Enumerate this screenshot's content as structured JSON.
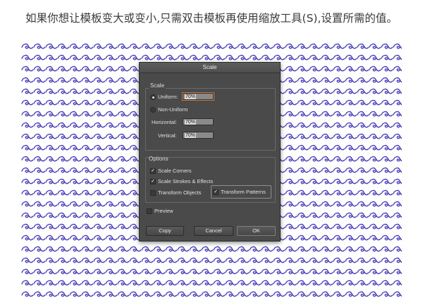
{
  "caption": "如果你想让模板变大或变小,只需双击模板再使用缩放工具(S),设置所需的值。",
  "pattern": {
    "stroke_color": "#4a3fb8",
    "icon": "wave-icon"
  },
  "dialog": {
    "title": "Scale",
    "scale_group": {
      "label": "Scale",
      "uniform_label": "Uniform:",
      "uniform_value": "70%",
      "non_uniform_label": "Non-Uniform",
      "horizontal_label": "Horizontal:",
      "horizontal_value": "70%",
      "vertical_label": "Vertical:",
      "vertical_value": "70%",
      "selected": "uniform"
    },
    "options_group": {
      "label": "Options",
      "scale_corners": {
        "label": "Scale Corners",
        "checked": true
      },
      "scale_strokes": {
        "label": "Scale Strokes & Effects",
        "checked": true
      },
      "transform_objects": {
        "label": "Transform Objects",
        "checked": false
      },
      "transform_patterns": {
        "label": "Transform Patterns",
        "checked": true
      }
    },
    "preview": {
      "label": "Preview",
      "checked": false
    },
    "buttons": {
      "copy": "Copy",
      "cancel": "Cancel",
      "ok": "OK"
    }
  }
}
